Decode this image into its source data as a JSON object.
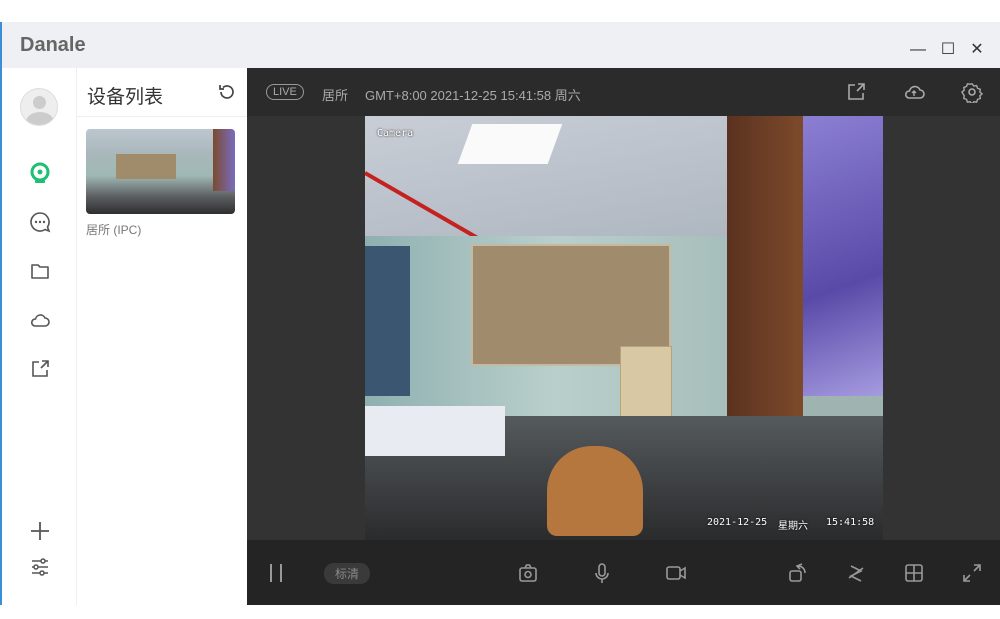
{
  "app": {
    "title": "Danale",
    "minimize": "—",
    "maximize": "☐",
    "close": "✕"
  },
  "sidebar": {
    "items": [
      {
        "name": "devices",
        "icon": "camera-icon",
        "active": true
      },
      {
        "name": "messages",
        "icon": "chat-icon"
      },
      {
        "name": "files",
        "icon": "folder-icon"
      },
      {
        "name": "cloud",
        "icon": "cloud-icon"
      },
      {
        "name": "share",
        "icon": "share-icon"
      }
    ],
    "add": "add-icon",
    "settings": "sliders-icon"
  },
  "device_list": {
    "title": "设备列表",
    "devices": [
      {
        "name": "居所 (IPC)"
      }
    ]
  },
  "player": {
    "live_badge": "LIVE",
    "device_name": "居所",
    "timestamp": "GMT+8:00 2021-12-25 15:41:58 周六",
    "overlay": {
      "label": "Camera",
      "date": "2021-12-25",
      "weekday": "星期六",
      "time": "15:41:58"
    },
    "quality": "标清"
  },
  "colors": {
    "accent": "#1dbf73",
    "dark": "#2b2b2b"
  }
}
